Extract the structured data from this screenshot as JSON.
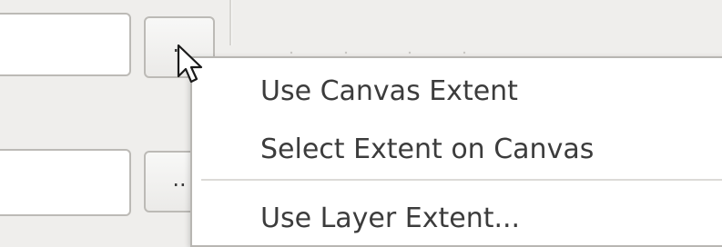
{
  "form": {
    "browse_button_1_label": "..",
    "browse_button_2_label": ".."
  },
  "context_menu": {
    "items": [
      {
        "label": "Use Canvas Extent"
      },
      {
        "label": "Select Extent on Canvas"
      },
      {
        "label": "Use Layer Extent..."
      }
    ]
  },
  "colors": {
    "menu_background": "#ffffff",
    "panel_background": "#efeeec",
    "text": "#3c3c3c"
  },
  "icons": {
    "cursor": "arrow-cursor-icon"
  }
}
